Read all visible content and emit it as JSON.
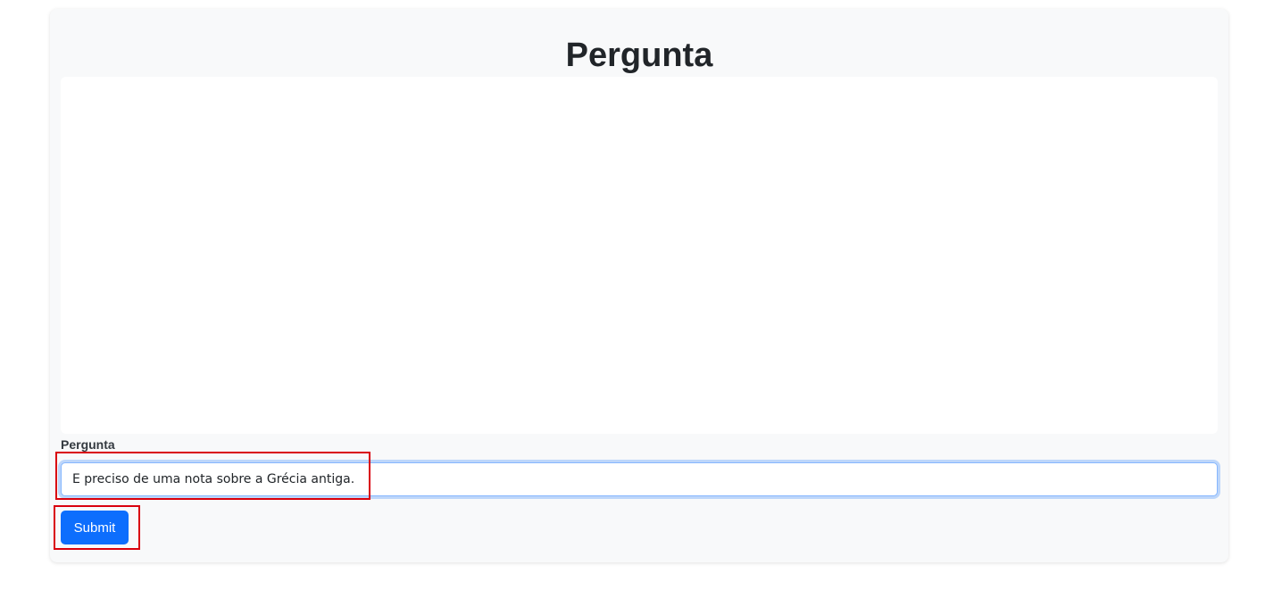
{
  "page": {
    "title": "Pergunta"
  },
  "form": {
    "label": "Pergunta",
    "input_value": "E preciso de uma nota sobre a Grécia antiga.",
    "submit_label": "Submit"
  },
  "colors": {
    "card_background": "#f8f9fa",
    "primary": "#0d6efd",
    "highlight": "#d9000d",
    "focus_border": "#86b7fe"
  }
}
